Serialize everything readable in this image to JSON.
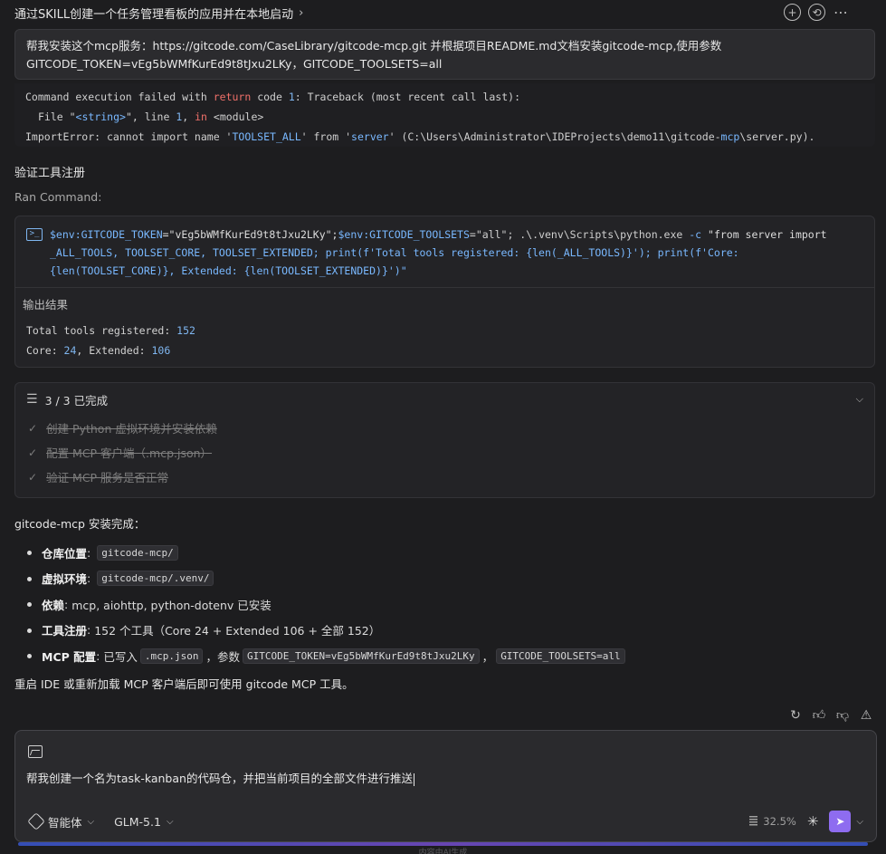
{
  "header": {
    "title": "通过SKILL创建一个任务管理看板的应用并在本地启动",
    "chevron": "›",
    "icons": [
      "add-icon",
      "history-icon",
      "more-icon"
    ]
  },
  "user_message": {
    "line1": "帮我安装这个mcp服务：https://gitcode.com/CaseLibrary/gitcode-mcp.git 并根据项目README.md文档安装gitcode-mcp,使用参数",
    "line2": "GITCODE_TOKEN=vEg5bWMfKurEd9t8tJxu2LKy，GITCODE_TOOLSETS=all"
  },
  "traceback": {
    "l1_a": "Command execution failed with ",
    "l1_kw": "return",
    "l1_b": " code ",
    "l1_num": "1",
    "l1_c": ": Traceback (most recent call last):",
    "l2_a": "File \"",
    "l2_str": "<string>",
    "l2_b": "\", line ",
    "l2_num": "1",
    "l2_c": ", ",
    "l2_kw": "in",
    "l2_d": " <module>",
    "l3_a": "ImportError: cannot import name '",
    "l3_str": "TOOLSET_ALL",
    "l3_b": "' from '",
    "l3_str2": "server",
    "l3_c": "' (C:\\Users\\Administrator\\IDEProjects\\demo11\\gitcode-",
    "l3_mcp": "mcp",
    "l3_d": "\\server.py)."
  },
  "section_title": "验证工具注册",
  "ran_label": "Ran Command:",
  "command": {
    "line1_var": "$env:GITCODE_TOKEN",
    "line1_eq": "=\"vEg5bWMfKurEd9t8tJxu2LKy\";",
    "line1_var2": "$env:GITCODE_TOOLSETS",
    "line1_rest": "=\"all\"; .\\.venv\\Scripts\\python.exe ",
    "line1_flag": "-c",
    "line1_str": " \"from server import",
    "line2": "_ALL_TOOLS, TOOLSET_CORE, TOOLSET_EXTENDED; print(f'Total tools registered: {len(_ALL_TOOLS)}'); print(f'Core:",
    "line3": "{len(TOOLSET_CORE)}, Extended: {len(TOOLSET_EXTENDED)}')\""
  },
  "output": {
    "label": "输出结果",
    "line1_label": "Total tools registered: ",
    "line1_value": "152",
    "line2_label": "Core: ",
    "line2_value": "24",
    "line2_mid": ", Extended: ",
    "line2_value2": "106"
  },
  "tasks": {
    "header": "3 / 3 已完成",
    "items": [
      "创建 Python 虚拟环境并安装依赖",
      "配置 MCP 客户端（.mcp.json）",
      "验证 MCP 服务是否正常"
    ]
  },
  "summary": {
    "intro": "gitcode-mcp 安装完成：",
    "b1_key": "仓库位置",
    "b1_code": "gitcode-mcp/",
    "b2_key": "虚拟环境",
    "b2_code": "gitcode-mcp/.venv/",
    "b3_key": "依赖",
    "b3_text": "mcp, aiohttp, python-dotenv 已安装",
    "b4_key": "工具注册",
    "b4_text": "152 个工具（Core 24 + Extended 106 + 全部 152）",
    "b5_key": "MCP 配置",
    "b5_text1": "已写入",
    "b5_code1": ".mcp.json",
    "b5_text2": "，参数",
    "b5_code2": "GITCODE_TOKEN=vEg5bWMfKurEd9t8tJxu2LKy",
    "b5_text3": "，",
    "b5_code3": "GITCODE_TOOLSETS=all",
    "colon": ":",
    "outro": "重启 IDE 或重新加载 MCP 客户端后即可使用 gitcode MCP 工具。"
  },
  "input": {
    "text": "帮我创建一个名为task-kanban的代码仓，并把当前项目的全部文件进行推送",
    "agent_label": "智能体",
    "model_label": "GLM-5.1",
    "usage": "32.5%"
  },
  "footer_note": "内容由AI生成",
  "colors": {
    "accent": "#8e6cf0",
    "keyword": "#f0706a",
    "number": "#7fb6f0"
  }
}
